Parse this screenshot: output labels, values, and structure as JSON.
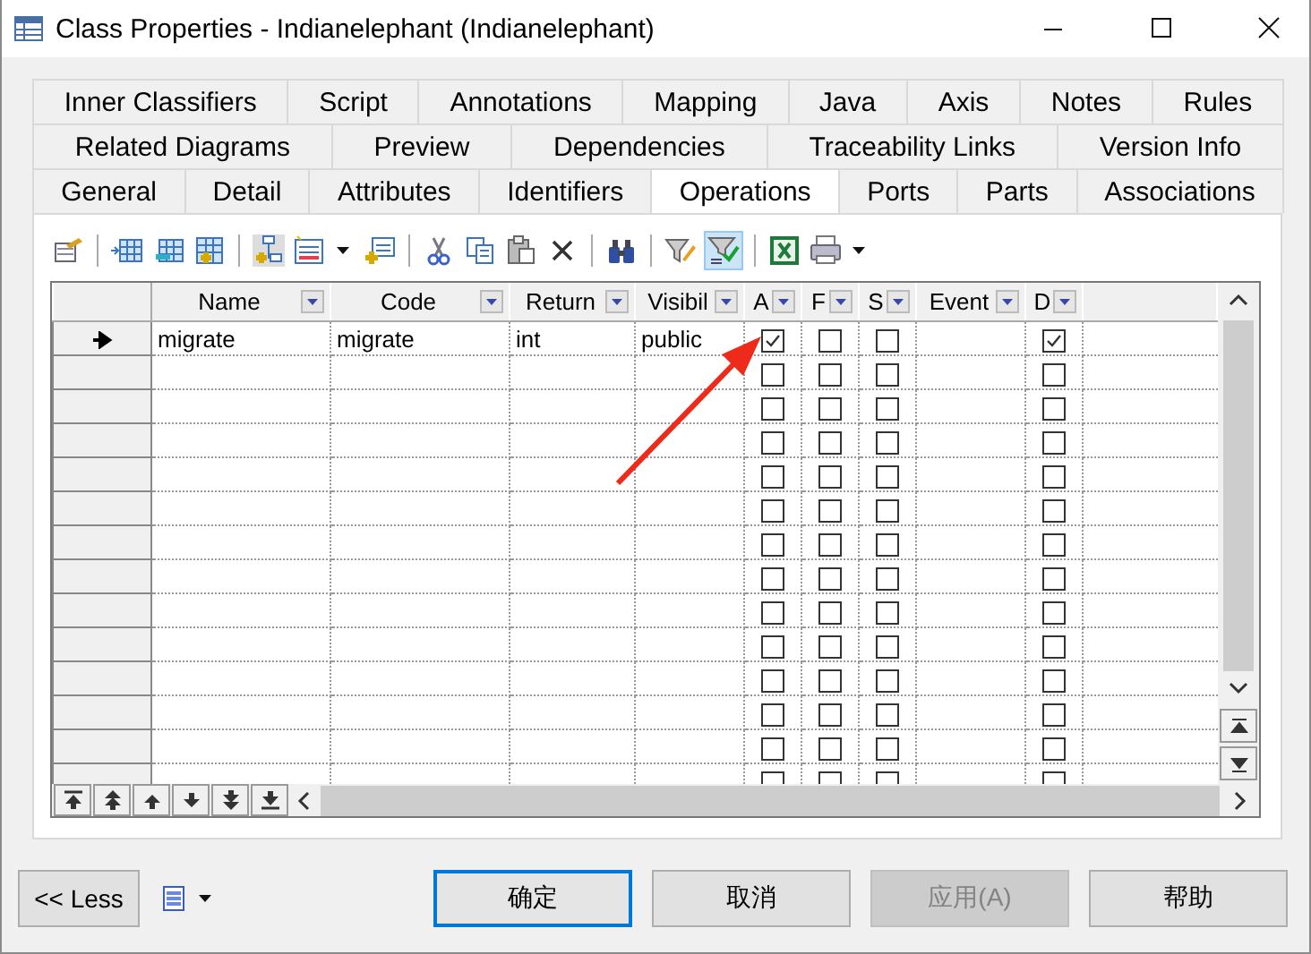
{
  "window": {
    "title": "Class Properties - Indianelephant (Indianelephant)"
  },
  "tab_rows": [
    [
      {
        "label": "Inner Classifiers",
        "selected": false
      },
      {
        "label": "Script",
        "selected": false
      },
      {
        "label": "Annotations",
        "selected": false
      },
      {
        "label": "Mapping",
        "selected": false
      },
      {
        "label": "Java",
        "selected": false
      },
      {
        "label": "Axis",
        "selected": false
      },
      {
        "label": "Notes",
        "selected": false
      },
      {
        "label": "Rules",
        "selected": false
      }
    ],
    [
      {
        "label": "Related Diagrams",
        "selected": false
      },
      {
        "label": "Preview",
        "selected": false
      },
      {
        "label": "Dependencies",
        "selected": false
      },
      {
        "label": "Traceability Links",
        "selected": false
      },
      {
        "label": "Version Info",
        "selected": false
      }
    ],
    [
      {
        "label": "General",
        "selected": false
      },
      {
        "label": "Detail",
        "selected": false
      },
      {
        "label": "Attributes",
        "selected": false
      },
      {
        "label": "Identifiers",
        "selected": false
      },
      {
        "label": "Operations",
        "selected": true
      },
      {
        "label": "Ports",
        "selected": false
      },
      {
        "label": "Parts",
        "selected": false
      },
      {
        "label": "Associations",
        "selected": false
      }
    ]
  ],
  "toolbar": {
    "filter_on": true
  },
  "grid": {
    "columns": [
      {
        "label": "Name",
        "kind": "text"
      },
      {
        "label": "Code",
        "kind": "text"
      },
      {
        "label": "Return",
        "kind": "text"
      },
      {
        "label": "Visibil",
        "kind": "text"
      },
      {
        "label": "A",
        "kind": "check"
      },
      {
        "label": "F",
        "kind": "check"
      },
      {
        "label": "S",
        "kind": "check"
      },
      {
        "label": "Event",
        "kind": "text"
      },
      {
        "label": "D",
        "kind": "check"
      }
    ],
    "rows": [
      {
        "current": true,
        "name": "migrate",
        "code": "migrate",
        "return": "int",
        "visibility": "public",
        "a": true,
        "f": false,
        "s": false,
        "d": true
      },
      {
        "current": false,
        "a": false,
        "f": false,
        "s": false,
        "d": false
      },
      {
        "current": false,
        "a": false,
        "f": false,
        "s": false,
        "d": false
      },
      {
        "current": false,
        "a": false,
        "f": false,
        "s": false,
        "d": false
      },
      {
        "current": false,
        "a": false,
        "f": false,
        "s": false,
        "d": false
      },
      {
        "current": false,
        "a": false,
        "f": false,
        "s": false,
        "d": false
      },
      {
        "current": false,
        "a": false,
        "f": false,
        "s": false,
        "d": false
      },
      {
        "current": false,
        "a": false,
        "f": false,
        "s": false,
        "d": false
      },
      {
        "current": false,
        "a": false,
        "f": false,
        "s": false,
        "d": false
      },
      {
        "current": false,
        "a": false,
        "f": false,
        "s": false,
        "d": false
      },
      {
        "current": false,
        "a": false,
        "f": false,
        "s": false,
        "d": false
      },
      {
        "current": false,
        "a": false,
        "f": false,
        "s": false,
        "d": false
      },
      {
        "current": false,
        "a": false,
        "f": false,
        "s": false,
        "d": false
      },
      {
        "current": false,
        "a": false,
        "f": false,
        "s": false,
        "d": false
      }
    ]
  },
  "buttons": [
    {
      "label": "<< Less",
      "kind": "less"
    },
    {
      "label": "确定",
      "kind": "action",
      "default": true,
      "disabled": false
    },
    {
      "label": "取消",
      "kind": "action",
      "default": false,
      "disabled": false
    },
    {
      "label": "应用(A)",
      "kind": "action",
      "default": false,
      "disabled": true
    },
    {
      "label": "帮助",
      "kind": "action",
      "default": false,
      "disabled": false
    }
  ]
}
